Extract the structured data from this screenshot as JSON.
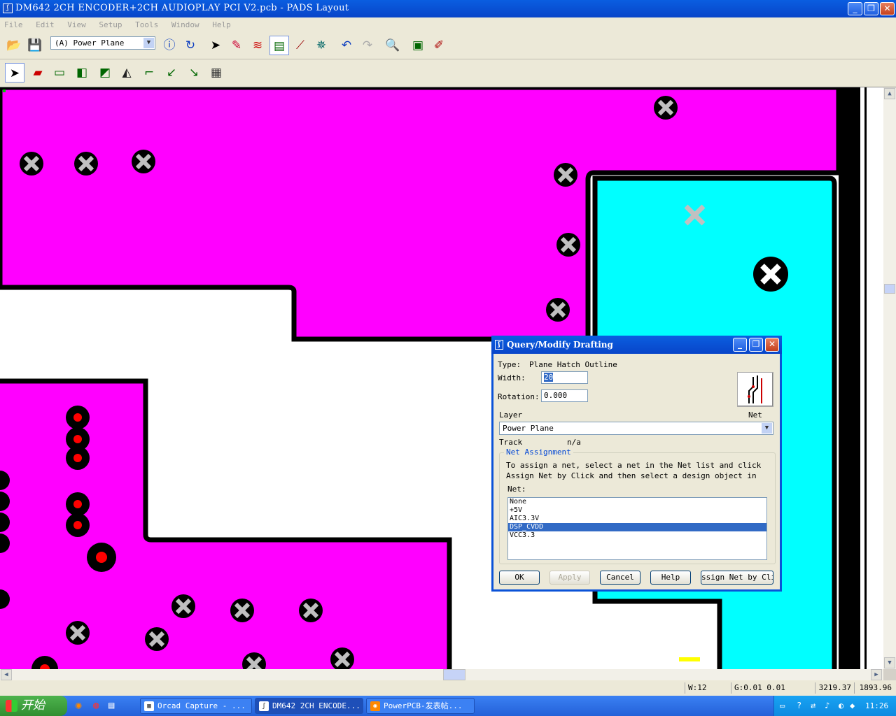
{
  "window": {
    "title": "DM642 2CH ENCODER+2CH AUDIOPLAY PCI V2.pcb - PADS Layout",
    "minimize": "_",
    "maximize": "❐",
    "close": "✕"
  },
  "menu": [
    "File",
    "Edit",
    "View",
    "Setup",
    "Tools",
    "Window",
    "Help"
  ],
  "toolbar": {
    "layer_select": "(A) Power Plane",
    "icons": [
      "open-folder-icon",
      "save-icon",
      "info-icon",
      "redraw-icon",
      "select-icon",
      "drafting-icon",
      "routing-icon",
      "design-toolbar-icon",
      "connect-icon",
      "ecos-icon",
      "undo-icon",
      "redo-icon",
      "zoom-icon",
      "verify-icon",
      "wizard-icon"
    ]
  },
  "drafting_toolbar": {
    "icons": [
      "select-mode-icon",
      "copper-icon",
      "copper-cutout-icon",
      "plane-area-icon",
      "plane-cutout-icon",
      "board-outline-icon",
      "2d-line-icon",
      "text-icon",
      "dimension-icon",
      "from-library-icon"
    ]
  },
  "colors": {
    "plane_magenta": "#ff00ff",
    "plane_cyan": "#00ffff",
    "pad_red": "#ff0000",
    "via_gray": "#c0c0c0",
    "selection": "#316ac5",
    "titlebar": "#0a5ee0"
  },
  "dialog": {
    "title": "Query/Modify Drafting",
    "type_label": "Type:",
    "type_value": "Plane Hatch Outline",
    "width_label": "Width:",
    "width_value": "20",
    "rotation_label": "Rotation:",
    "rotation_value": "0.000",
    "layer_label": "Layer",
    "net_button_label": "Net",
    "layer_value": "Power Plane",
    "track_label": "Track",
    "track_value": "n/a",
    "group_title": "Net Assignment",
    "instructions_1": "To assign a net, select a net in the Net list and click",
    "instructions_2": "Assign Net by Click and then select a design object in",
    "net_label": "Net:",
    "nets": [
      "None",
      "+5V",
      "AIC3.3V",
      "DSP_CVDD",
      "VCC3.3"
    ],
    "selected_net": "DSP_CVDD",
    "buttons": {
      "ok": "OK",
      "apply": "Apply",
      "cancel": "Cancel",
      "help": "Help",
      "assign": "ssign Net by Clic"
    }
  },
  "status": {
    "width": "W:12",
    "grid": "G:0.01 0.01",
    "x": "3219.37",
    "y": "1893.96"
  },
  "taskbar": {
    "start": "开始",
    "tasks": [
      "Orcad Capture - ...",
      "DM642 2CH ENCODE...",
      "PowerPCB-发表帖..."
    ],
    "clock": "11:26"
  }
}
